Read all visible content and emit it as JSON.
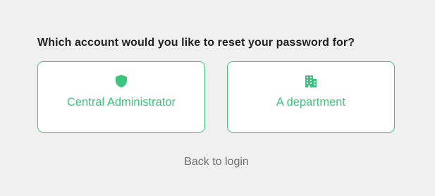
{
  "prompt": {
    "question": "Which account would you like to reset your password for?"
  },
  "options": [
    {
      "label": "Central Administrator",
      "icon": "shield-icon"
    },
    {
      "label": "A department",
      "icon": "building-icon"
    }
  ],
  "footer": {
    "back_link": "Back to login"
  },
  "colors": {
    "background": "#f0f0f0",
    "accent": "#3cc47c",
    "text": "#222222",
    "muted": "#6f6f6f"
  }
}
